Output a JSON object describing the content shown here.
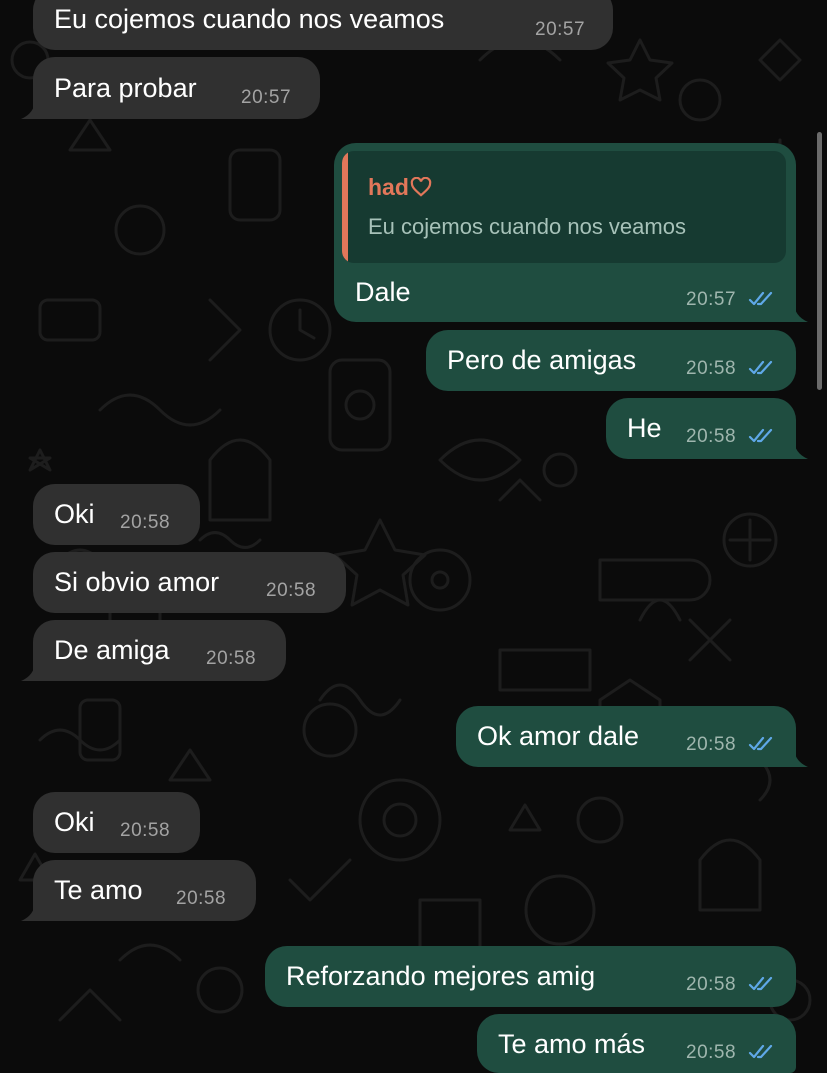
{
  "colors": {
    "background": "#0b0b0b",
    "incoming_bubble": "#303030",
    "outgoing_bubble": "#1f4d40",
    "reply_accent": "#e2775a",
    "read_ticks": "#5fa8e8"
  },
  "messages": [
    {
      "direction": "in",
      "text": "Eu cojemos cuando nos veamos",
      "time": "20:57"
    },
    {
      "direction": "in",
      "text": "Para probar",
      "time": "20:57"
    },
    {
      "direction": "out",
      "text": "Dale",
      "time": "20:57",
      "status_icon": "double-check-read-icon",
      "reply_to": {
        "author": "had",
        "author_icon": "heart-outline-icon",
        "text": "Eu cojemos cuando nos veamos"
      }
    },
    {
      "direction": "out",
      "text": "Pero de amigas",
      "time": "20:58",
      "status_icon": "double-check-read-icon"
    },
    {
      "direction": "out",
      "text": "He",
      "time": "20:58",
      "status_icon": "double-check-read-icon"
    },
    {
      "direction": "in",
      "text": "Oki",
      "time": "20:58"
    },
    {
      "direction": "in",
      "text": "Si obvio amor",
      "time": "20:58"
    },
    {
      "direction": "in",
      "text": "De amiga",
      "time": "20:58"
    },
    {
      "direction": "out",
      "text": "Ok amor dale",
      "time": "20:58",
      "status_icon": "double-check-read-icon"
    },
    {
      "direction": "in",
      "text": "Oki",
      "time": "20:58"
    },
    {
      "direction": "in",
      "text": "Te amo",
      "time": "20:58"
    },
    {
      "direction": "out",
      "text": "Reforzando mejores amig",
      "time": "20:58",
      "status_icon": "double-check-read-icon"
    },
    {
      "direction": "out",
      "text": "Te amo más",
      "time": "20:58",
      "status_icon": "double-check-read-icon"
    }
  ]
}
